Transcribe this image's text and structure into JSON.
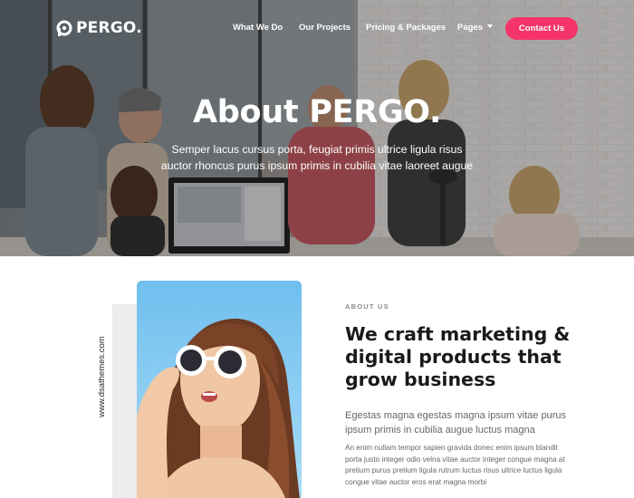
{
  "brand": {
    "name": "PERGO."
  },
  "nav": {
    "links": [
      "What We Do",
      "Our Projects",
      "Pricing & Packages",
      "Pages"
    ],
    "cta": "Contact Us"
  },
  "hero": {
    "title": "About PERGO.",
    "subtitle": "Semper lacus cursus porta, feugiat primis ultrice ligula risus auctor rhoncus purus ipsum primis in cubilia vitae laoreet augue"
  },
  "about": {
    "side_label": "www.dsathemes.com",
    "eyebrow": "ABOUT US",
    "heading": "We craft marketing & digital products that grow business",
    "lead": "Egestas magna egestas magna ipsum vitae purus ipsum primis in cubilia augue luctus magna",
    "body": "An enim nullam tempor sapien gravida donec enim ipsum blandit porta justo integer odio velna vitae auctor integer congue magna at pretium purus pretium ligula rutrum luctus risus ultrice luctus ligula congue vitae auctor eros erat magna morbi"
  },
  "colors": {
    "accent": "#f5356a",
    "heading": "#1a1a1a",
    "text": "#666666",
    "sky": "#7cc5ee"
  },
  "icons": {
    "logo": "pergo-logo-icon",
    "dropdown": "chevron-down-icon"
  }
}
